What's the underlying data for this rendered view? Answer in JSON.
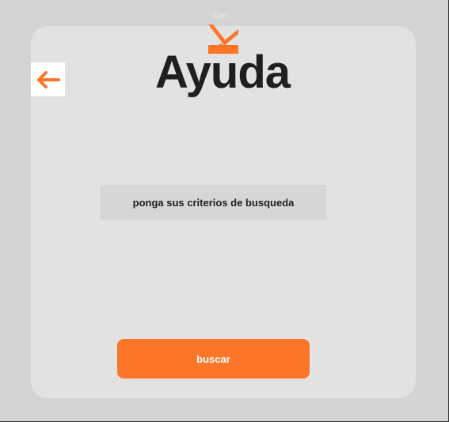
{
  "header": {
    "caption": "kan...",
    "title": "Ayuda"
  },
  "logo": {
    "icon": "crossed-tools-icon",
    "color": "#fb7628"
  },
  "back": {
    "icon": "arrow-left-icon",
    "color": "#fb7628"
  },
  "search": {
    "placeholder": "ponga sus criterios de busqueda",
    "button_label": "buscar"
  },
  "colors": {
    "accent": "#fb7628",
    "background": "#d4d4d4",
    "card": "#e2e2e2",
    "field": "#d6d6d6",
    "text": "#1f1f1f"
  }
}
